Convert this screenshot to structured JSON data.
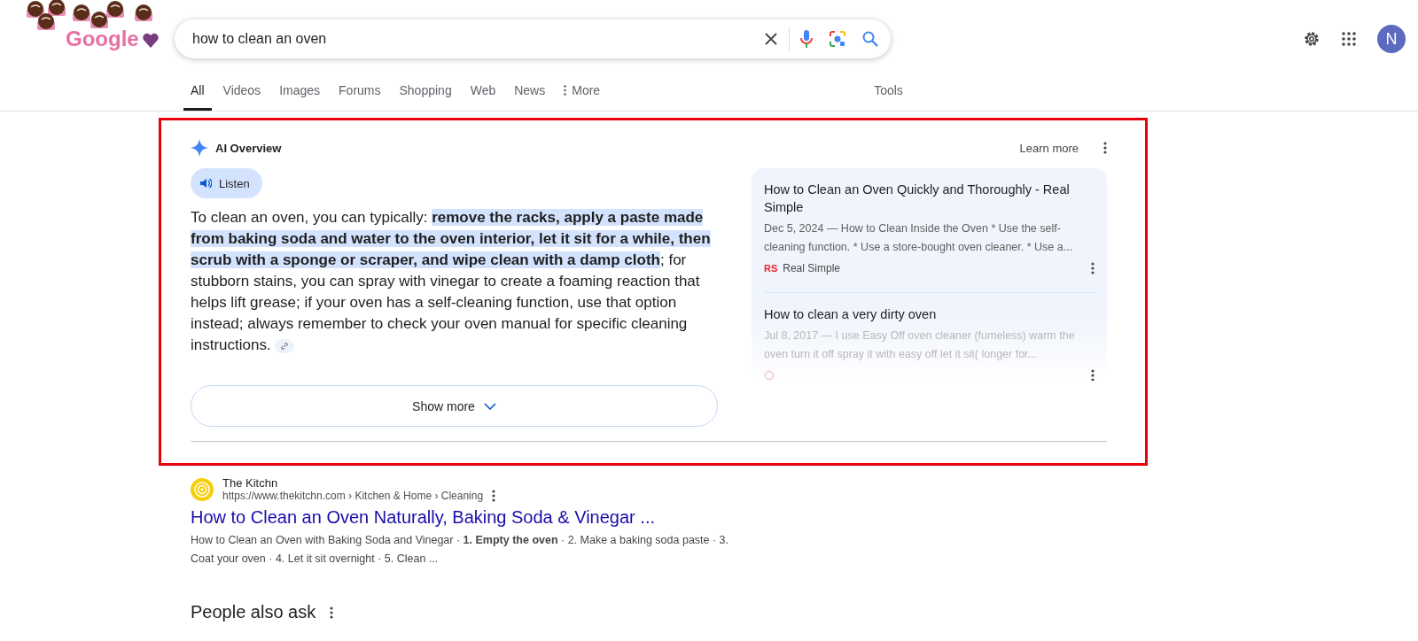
{
  "logo": {
    "text": "Google"
  },
  "search": {
    "value": "how to clean an oven"
  },
  "account": {
    "initial": "N"
  },
  "tabs": [
    {
      "label": "All",
      "selected": true
    },
    {
      "label": "Videos",
      "selected": false
    },
    {
      "label": "Images",
      "selected": false
    },
    {
      "label": "Forums",
      "selected": false
    },
    {
      "label": "Shopping",
      "selected": false
    },
    {
      "label": "Web",
      "selected": false
    },
    {
      "label": "News",
      "selected": false
    },
    {
      "label": "More",
      "selected": false,
      "kind": "menu"
    }
  ],
  "tools": "Tools",
  "ai_overview": {
    "title": "AI Overview",
    "learn_more": "Learn more",
    "listen": "Listen",
    "summary": "To clean an oven, you can typically: **remove the racks, apply a paste made from baking soda and water to the oven interior, let it sit for a while, then scrub with a sponge or scraper, and wipe clean with a damp cloth**; for stubborn stains, you can spray with vinegar to create a foaming reaction that helps lift grease; if your oven has a self-cleaning function, use that option instead; always remember to check your oven manual for specific cleaning instructions.",
    "show_more": "Show more",
    "sources": [
      {
        "title": "How to Clean an Oven Quickly and Thoroughly - Real Simple",
        "snippet": "Dec 5, 2024 — How to Clean Inside the Oven * Use the self-cleaning function. * Use a store-bought oven cleaner. * Use a...",
        "site": "Real Simple",
        "badge": "RS"
      },
      {
        "title": "How to clean a very dirty oven",
        "snippet": "Jul 8, 2017 — I use Easy Off oven cleaner (fumeless) warm the oven turn it off spray it with easy off let it sit( longer for..."
      }
    ]
  },
  "result": {
    "site": "The Kitchn",
    "url": "https://www.thekitchn.com › Kitchen & Home › Cleaning",
    "title": "How to Clean an Oven Naturally, Baking Soda & Vinegar ...",
    "snippet": "How to Clean an Oven with Baking Soda and Vinegar · **1. Empty the oven** · 2. Make a baking soda paste · 3. Coat your oven · 4. Let it sit overnight · 5. Clean ..."
  },
  "people_also_ask": "People also ask"
}
